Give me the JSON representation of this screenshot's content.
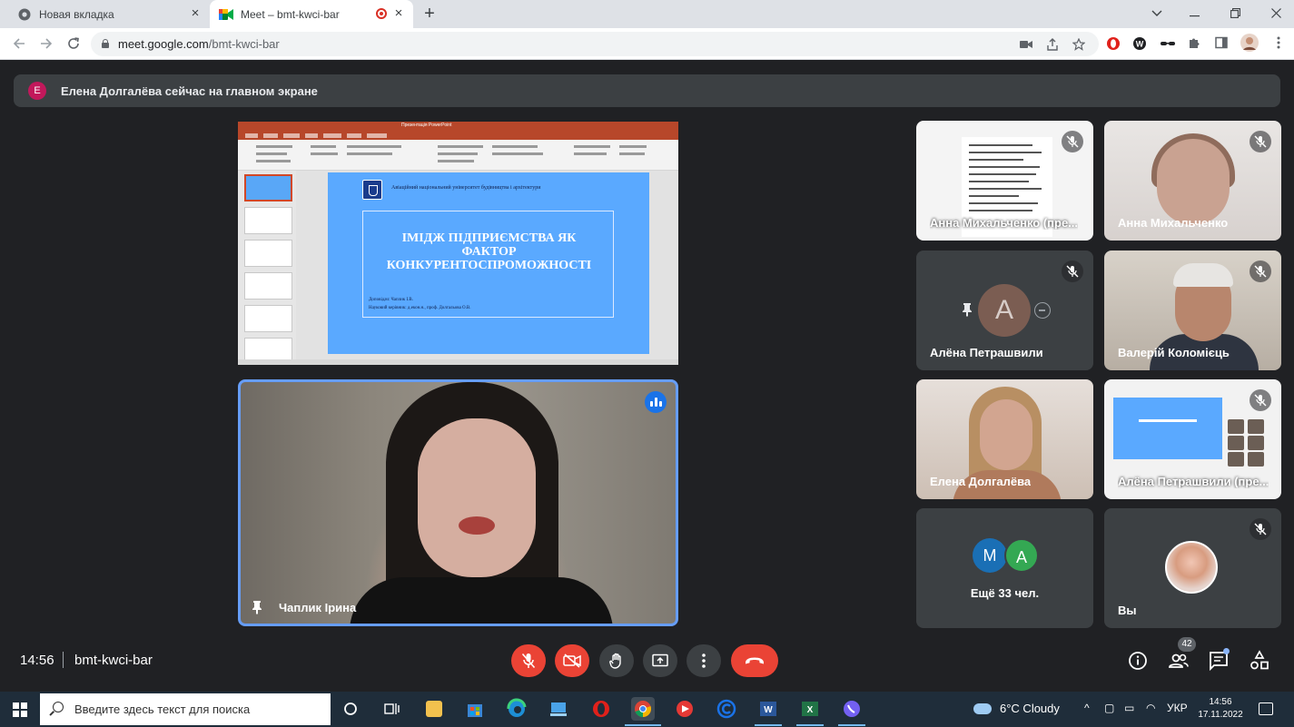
{
  "browser": {
    "tabs": [
      {
        "title": "Новая вкладка"
      },
      {
        "title": "Meet – bmt-kwci-bar"
      }
    ],
    "url_host": "meet.google.com",
    "url_path": "/bmt-kwci-bar"
  },
  "banner": {
    "avatar_letter": "E",
    "text": "Елена Долгалёва сейчас на главном экране"
  },
  "presentation": {
    "university": "Авіаційний національний університет будівництва і архітектури",
    "title_line1": "ІМІДЖ ПІДПРИЄМСТВА ЯК",
    "title_line2": "ФАКТОР",
    "title_line3": "КОНКУРЕНТОСПРОМОЖНОСТІ",
    "author_line": "Доповідач: Чаплик І.В.",
    "advisor_line": "Науковий керівник: д.екон.н., проф. Долгальова О.В."
  },
  "speaker": {
    "name": "Чаплик Ірина"
  },
  "participants": [
    {
      "name": "Анна Михальченко (пре...",
      "kind": "screen",
      "muted": true
    },
    {
      "name": "Анна Михальченко",
      "kind": "camera",
      "muted": true
    },
    {
      "name": "Алёна Петрашвили",
      "kind": "avatar",
      "avatar_letter": "A",
      "muted": true
    },
    {
      "name": "Валерій Коломієць",
      "kind": "camera",
      "muted": true
    },
    {
      "name": "Елена Долгалёва",
      "kind": "camera",
      "muted": false
    },
    {
      "name": "Алёна Петрашвили (пре...",
      "kind": "screen",
      "muted": true
    }
  ],
  "more": {
    "avatars": [
      {
        "letter": "M",
        "color": "#1a6fb5"
      },
      {
        "letter": "A",
        "color": "#34a853"
      }
    ],
    "label": "Ещё 33 чел."
  },
  "you": {
    "name": "Вы",
    "muted": true
  },
  "bottom": {
    "time": "14:56",
    "meeting_code": "bmt-kwci-bar",
    "participant_count": "42"
  },
  "taskbar": {
    "search_placeholder": "Введите здесь текст для поиска",
    "weather": "6°C  Cloudy",
    "language": "УКР",
    "clock_time": "14:56",
    "clock_date": "17.11.2022"
  },
  "colors": {
    "meet_bg": "#202124",
    "tile_bg": "#3c4043",
    "hangup_red": "#ea4335",
    "active_speaker_border": "#669df6",
    "slide_blue": "#5aa9ff"
  }
}
